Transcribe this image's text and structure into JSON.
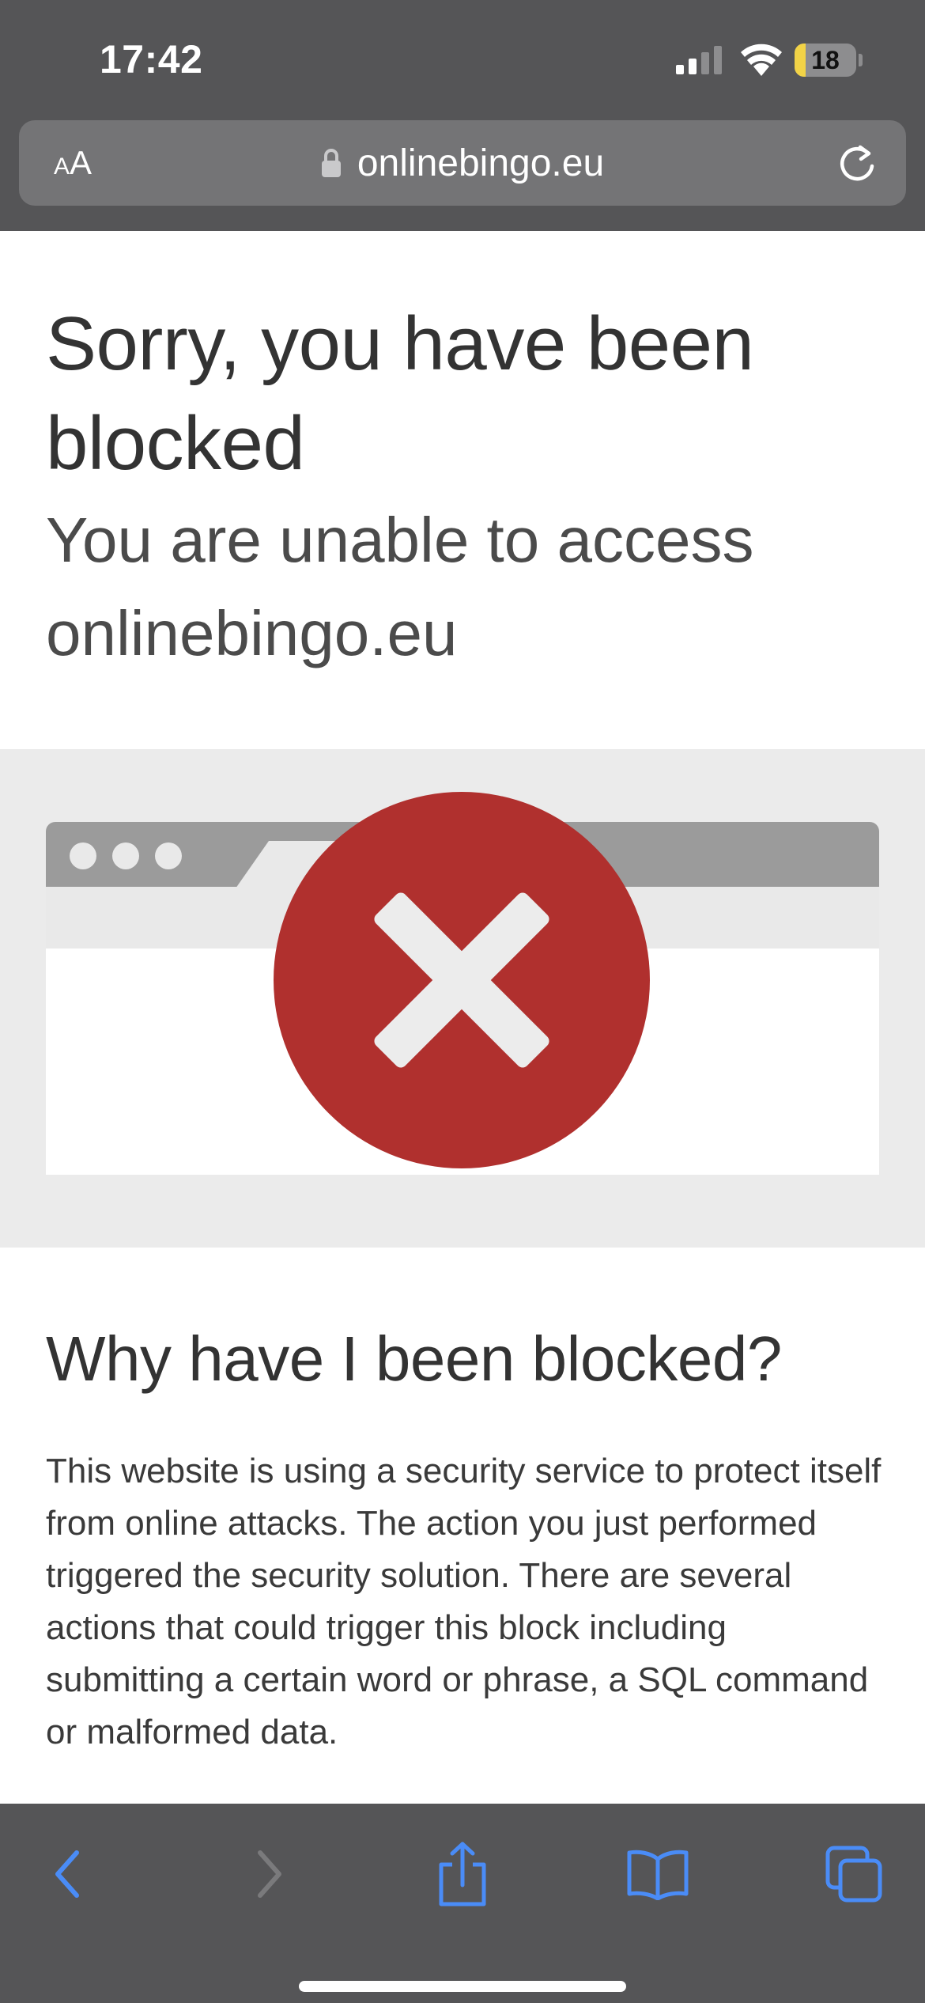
{
  "status_bar": {
    "time": "17:42",
    "battery_level": "18",
    "battery_fraction": 0.18
  },
  "address_bar": {
    "text_size_button": "AA",
    "url": "onlinebingo.eu",
    "lock_icon": "lock-icon",
    "reload_icon": "reload-icon"
  },
  "page": {
    "title": "Sorry, you have been blocked",
    "subtitle": "You are unable to access onlinebingo.eu",
    "illustration_icon": "blocked-x-icon",
    "why_title": "Why have I been blocked?",
    "why_body": "This website is using a security service to protect itself from online attacks. The action you just performed triggered the security solution. There are several actions that could trigger this block including submitting a certain word or phrase, a SQL command or malformed data."
  },
  "toolbar": {
    "icons": [
      "back-icon",
      "forward-icon",
      "share-icon",
      "bookmarks-icon",
      "tabs-icon"
    ]
  },
  "colors": {
    "chrome": "#555557",
    "address_field": "#747476",
    "accent_blue": "#4a8cf7",
    "blocked_red": "#b0302e",
    "band_gray": "#ebebeb"
  }
}
